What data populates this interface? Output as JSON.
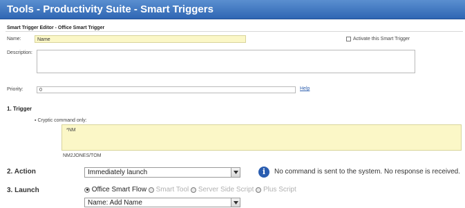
{
  "window": {
    "title": "Tools - Productivity Suite - Smart Triggers"
  },
  "editor": {
    "heading": "Smart Trigger Editor - Office Smart Trigger",
    "name_label": "Name:",
    "name_value": "Name",
    "activate_label": "Activate this Smart Trigger",
    "activate_checked": false,
    "description_label": "Description:",
    "description_value": "",
    "priority_label": "Priority:",
    "priority_value": "0",
    "help_link": "Help"
  },
  "trigger": {
    "heading": "1. Trigger",
    "option_label": "Cryptic command only:",
    "command_value": "*NM",
    "sub_value": "NM2JONES/TOM"
  },
  "action": {
    "heading": "2. Action",
    "selected": "Immediately launch",
    "info_icon": "info-icon",
    "info_text": "No command is sent to the system. No response is received."
  },
  "launch": {
    "heading": "3. Launch",
    "options": [
      {
        "label": "Office Smart Flow",
        "selected": true,
        "enabled": true
      },
      {
        "label": "Smart Tool",
        "selected": false,
        "enabled": false
      },
      {
        "label": "Server Side Script",
        "selected": false,
        "enabled": false
      },
      {
        "label": "Plus Script",
        "selected": false,
        "enabled": false
      }
    ],
    "name_selected": "Name: Add Name"
  },
  "colors": {
    "title_bar": "#2f66b3",
    "highlight_input": "#fbf7c7",
    "link": "#2e5fae",
    "info_icon": "#2a5db0"
  }
}
